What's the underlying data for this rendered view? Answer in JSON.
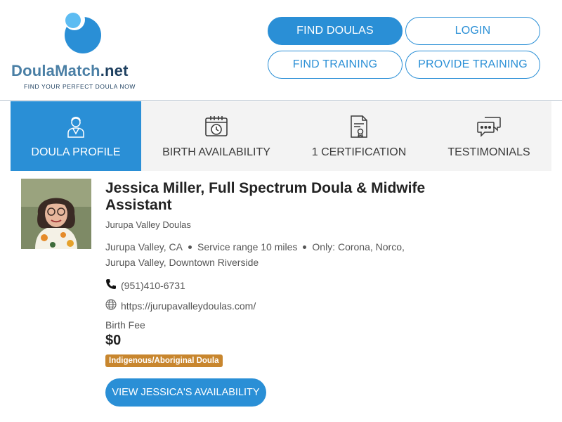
{
  "brand": {
    "name_part1": "Doula",
    "name_part2": "Match",
    "name_part3": ".net",
    "tagline": "FIND YOUR PERFECT DOULA NOW",
    "colors": {
      "primary": "#2a8fd6",
      "dark": "#1d3f5f",
      "badge": "#c8862e"
    }
  },
  "nav": {
    "find_doulas": "FIND DOULAS",
    "login": "LOGIN",
    "find_training": "FIND TRAINING",
    "provide_training": "PROVIDE TRAINING"
  },
  "tabs": [
    {
      "label": "DOULA PROFILE",
      "icon": "person-icon",
      "active": true
    },
    {
      "label": "BIRTH AVAILABILITY",
      "icon": "calendar-clock-icon",
      "active": false
    },
    {
      "label": "1 CERTIFICATION",
      "icon": "certificate-icon",
      "active": false
    },
    {
      "label": "TESTIMONIALS",
      "icon": "chat-bubbles-icon",
      "active": false
    }
  ],
  "profile": {
    "name": "Jessica Miller, Full Spectrum Doula & Midwife Assistant",
    "agency": "Jurupa Valley Doulas",
    "city": "Jurupa Valley, CA",
    "service_range": "Service range 10 miles",
    "only_areas": "Only: Corona, Norco, Jurupa Valley, Downtown Riverside",
    "phone": "(951)410-6731",
    "website": "https://jurupavalleydoulas.com/",
    "fee_label": "Birth Fee",
    "fee_value": "$0",
    "badge": "Indigenous/Aboriginal Doula",
    "availability_button": "VIEW JESSICA'S AVAILABILITY"
  }
}
